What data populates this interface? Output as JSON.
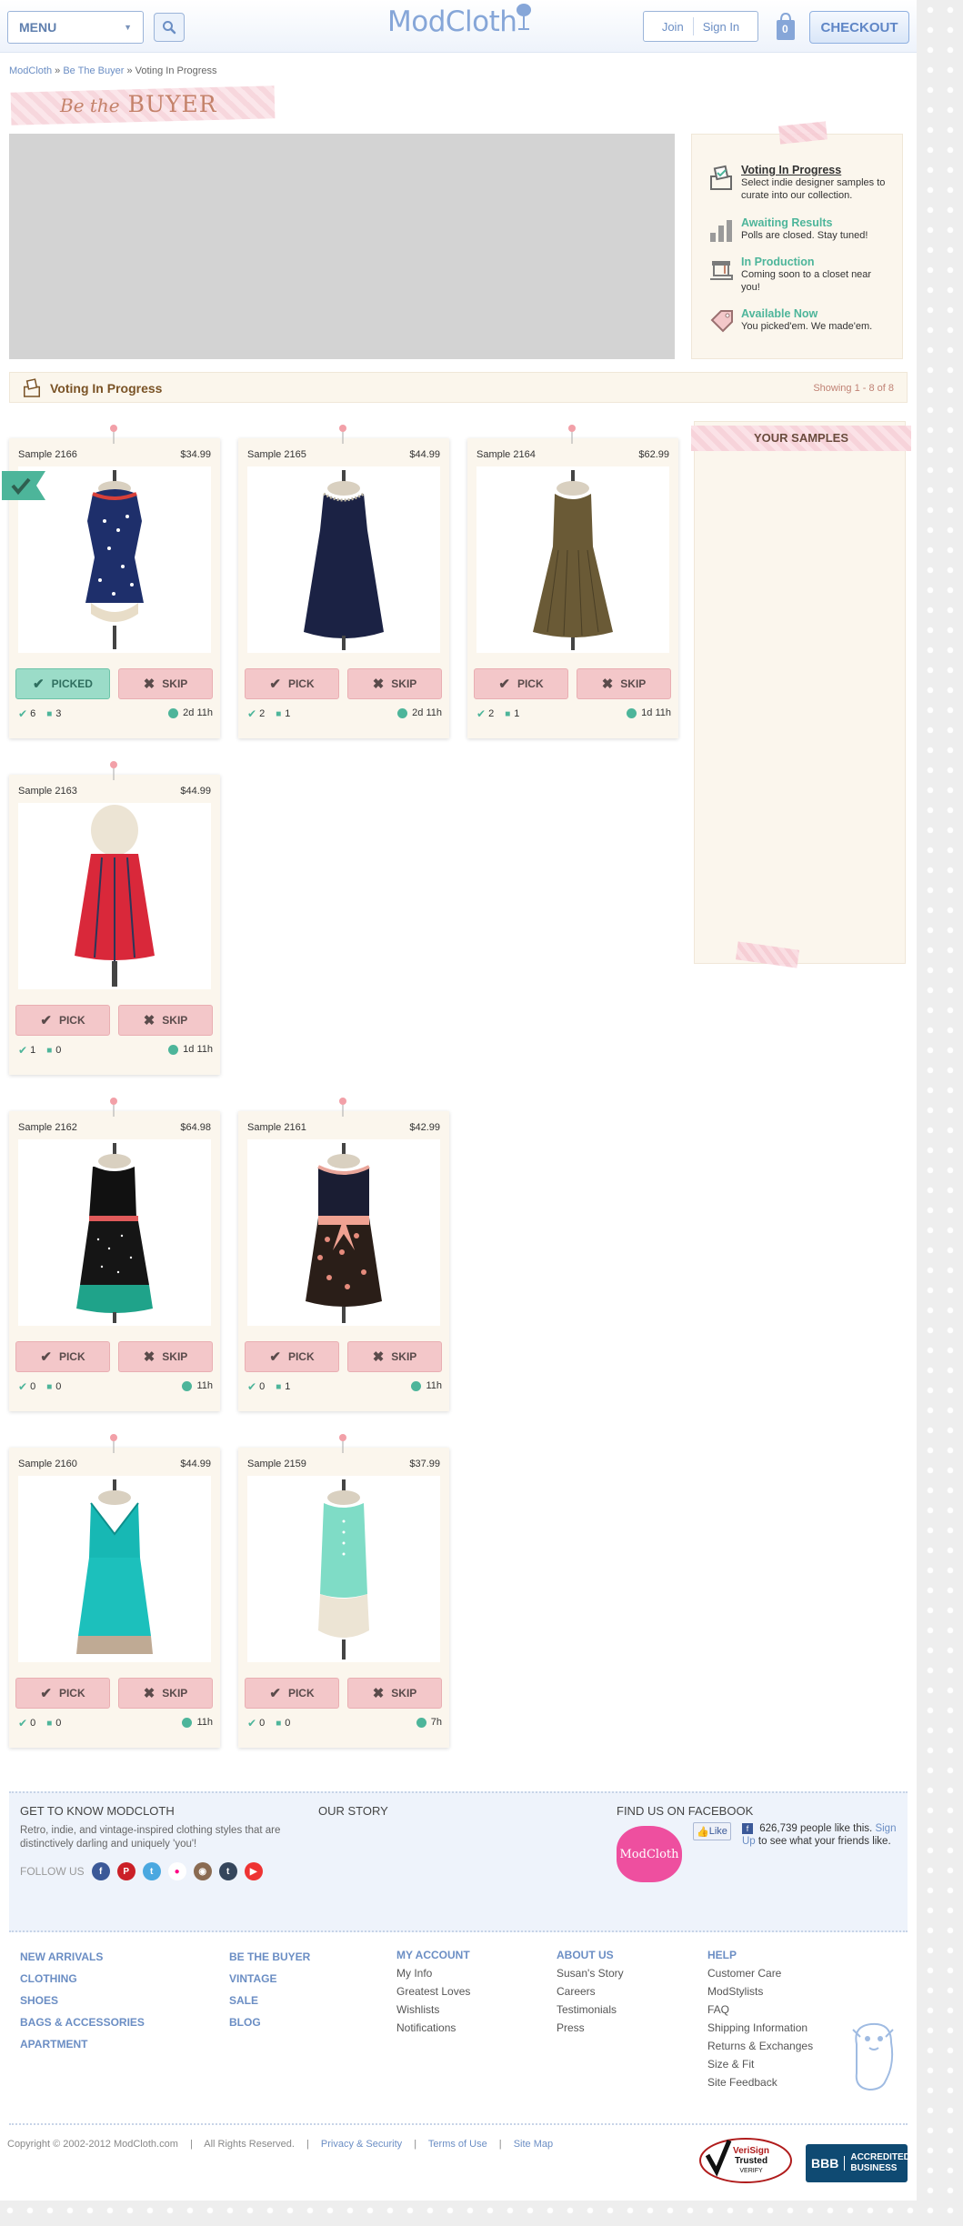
{
  "header": {
    "menu_label": "MENU",
    "logo_text": "ModCloth",
    "join_label": "Join",
    "signin_label": "Sign In",
    "bag_count": "0",
    "checkout_label": "CHECKOUT"
  },
  "breadcrumb": {
    "home": "ModCloth",
    "section": "Be The Buyer",
    "current": "Voting In Progress",
    "separator": "»"
  },
  "page_title": {
    "prefix": "Be the",
    "main": "BUYER"
  },
  "status_steps": [
    {
      "title": "Voting In Progress",
      "desc": "Select indie designer samples to curate into our collection."
    },
    {
      "title": "Awaiting Results",
      "desc": "Polls are closed. Stay tuned!"
    },
    {
      "title": "In Production",
      "desc": "Coming soon to a closet near you!"
    },
    {
      "title": "Available Now",
      "desc": "You picked'em. We made'em."
    }
  ],
  "voting_bar": {
    "title": "Voting In Progress",
    "showing": "Showing 1 - 8 of 8"
  },
  "products": [
    {
      "sample": "Sample 2166",
      "price": "$34.99",
      "pick": "PICKED",
      "skip": "SKIP",
      "picks": "6",
      "comments": "3",
      "time": "2d 11h"
    },
    {
      "sample": "Sample 2165",
      "price": "$44.99",
      "pick": "PICK",
      "skip": "SKIP",
      "picks": "2",
      "comments": "1",
      "time": "2d 11h"
    },
    {
      "sample": "Sample 2164",
      "price": "$62.99",
      "pick": "PICK",
      "skip": "SKIP",
      "picks": "2",
      "comments": "1",
      "time": "1d 11h"
    },
    {
      "sample": "Sample 2163",
      "price": "$44.99",
      "pick": "PICK",
      "skip": "SKIP",
      "picks": "1",
      "comments": "0",
      "time": "1d 11h"
    },
    {
      "sample": "Sample 2162",
      "price": "$64.98",
      "pick": "PICK",
      "skip": "SKIP",
      "picks": "0",
      "comments": "0",
      "time": "11h"
    },
    {
      "sample": "Sample 2161",
      "price": "$42.99",
      "pick": "PICK",
      "skip": "SKIP",
      "picks": "0",
      "comments": "1",
      "time": "11h"
    },
    {
      "sample": "Sample 2160",
      "price": "$44.99",
      "pick": "PICK",
      "skip": "SKIP",
      "picks": "0",
      "comments": "0",
      "time": "11h"
    },
    {
      "sample": "Sample 2159",
      "price": "$37.99",
      "pick": "PICK",
      "skip": "SKIP",
      "picks": "0",
      "comments": "0",
      "time": "7h"
    }
  ],
  "your_samples": {
    "title": "YOUR SAMPLES"
  },
  "footer": {
    "get_to_know": "GET TO KNOW MODCLOTH",
    "description": "Retro, indie, and vintage-inspired clothing styles that are distinctively darling and uniquely 'you'!",
    "follow_us": "FOLLOW US",
    "our_story": "OUR STORY",
    "find_us": "FIND US ON FACEBOOK",
    "fb_logo_text": "ModCloth",
    "like": "Like",
    "fb_count": "626,739 people like this.",
    "fb_signup": "Sign Up",
    "fb_rest": "to see what your friends like.",
    "col1": [
      "NEW ARRIVALS",
      "CLOTHING",
      "SHOES",
      "BAGS & ACCESSORIES",
      "APARTMENT"
    ],
    "col2": [
      "BE THE BUYER",
      "VINTAGE",
      "SALE",
      "BLOG"
    ],
    "my_account": {
      "head": "MY ACCOUNT",
      "links": [
        "My Info",
        "Greatest Loves",
        "Wishlists",
        "Notifications"
      ]
    },
    "about_us": {
      "head": "ABOUT US",
      "links": [
        "Susan's Story",
        "Careers",
        "Testimonials",
        "Press"
      ]
    },
    "help": {
      "head": "HELP",
      "links": [
        "Customer Care",
        "ModStylists",
        "FAQ",
        "Shipping Information",
        "Returns & Exchanges",
        "Size & Fit",
        "Site Feedback"
      ]
    },
    "copyright": "Copyright © 2002-2012 ModCloth.com",
    "rights": "All Rights Reserved.",
    "privacy": "Privacy & Security",
    "terms": "Terms of Use",
    "sitemap": "Site Map",
    "verisign_line1": "VeriSign",
    "verisign_line2": "Trusted",
    "verisign_line3": "VERIFY",
    "bbb_logo": "BBB",
    "bbb_line1": "ACCREDITED",
    "bbb_line2": "BUSINESS"
  },
  "colors": {
    "accent_blue": "#6b8ec4",
    "teal": "#4db59a",
    "pink": "#f3c7c9",
    "panel": "#fbf6ed"
  }
}
